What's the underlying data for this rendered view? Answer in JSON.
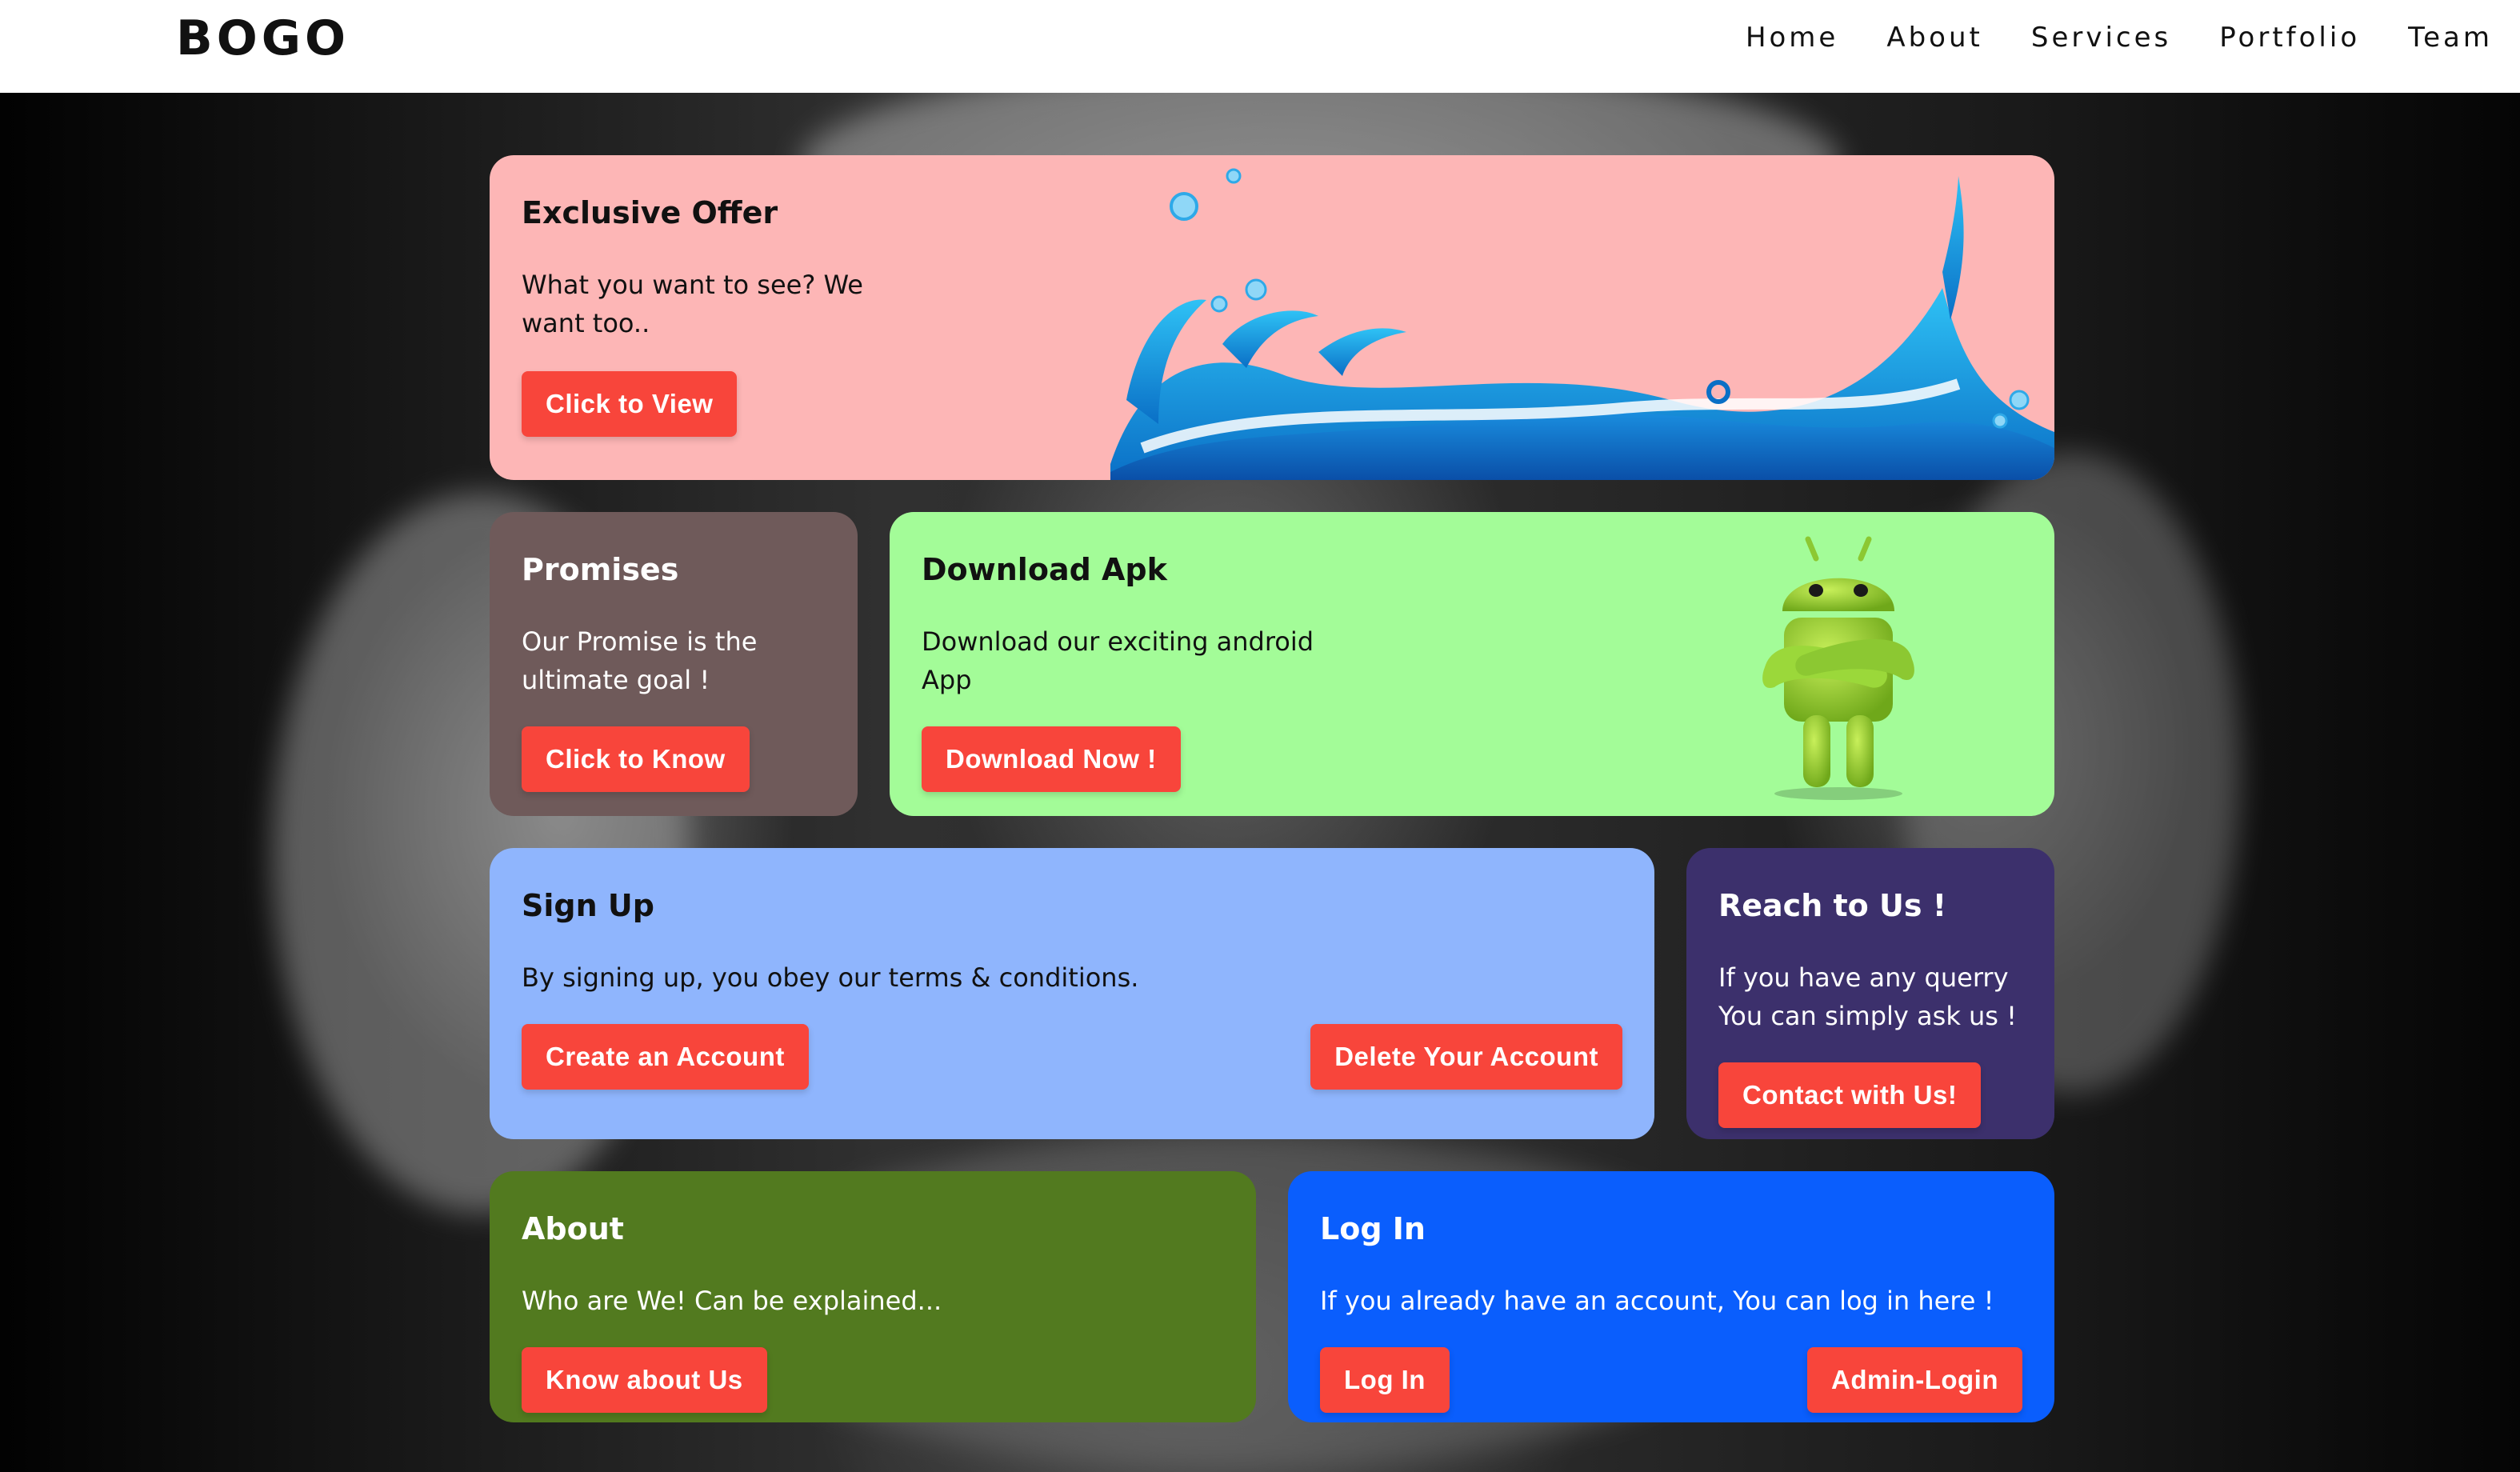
{
  "nav": {
    "brand": "BOGO",
    "links": [
      "Home",
      "About",
      "Services",
      "Portfolio",
      "Team"
    ]
  },
  "cards": {
    "offer": {
      "title": "Exclusive Offer",
      "text": "What you want to see? We want too..",
      "button": "Click to View"
    },
    "promises": {
      "title": "Promises",
      "text": "Our Promise is the ultimate goal !",
      "button": "Click to Know"
    },
    "apk": {
      "title": "Download Apk",
      "text": "Download our exciting android App",
      "button": "Download Now !"
    },
    "signup": {
      "title": "Sign Up",
      "text": "By signing up, you obey our terms & conditions.",
      "button_create": "Create an Account",
      "button_delete": "Delete Your Account"
    },
    "reach": {
      "title": "Reach to Us !",
      "text": "If you have any querry You can simply ask us !",
      "button": "Contact with Us!"
    },
    "about": {
      "title": "About",
      "text": "Who are We! Can be explained...",
      "button": "Know about Us"
    },
    "login": {
      "title": "Log In",
      "text": "If you already have an account, You can log in here !",
      "button_login": "Log In",
      "button_admin": "Admin-Login"
    }
  },
  "colors": {
    "button": "#f8453b",
    "offer_bg": "#fdb6b6",
    "promises_bg": "#6f5a5a",
    "apk_bg": "#a3fc98",
    "signup_bg": "#8fb5fd",
    "reach_bg": "#3c306c",
    "about_bg": "#527a1f",
    "login_bg": "#0a5efd"
  },
  "icons": {
    "offer_art": "water-wave-illustration",
    "apk_art": "android-robot-illustration"
  }
}
